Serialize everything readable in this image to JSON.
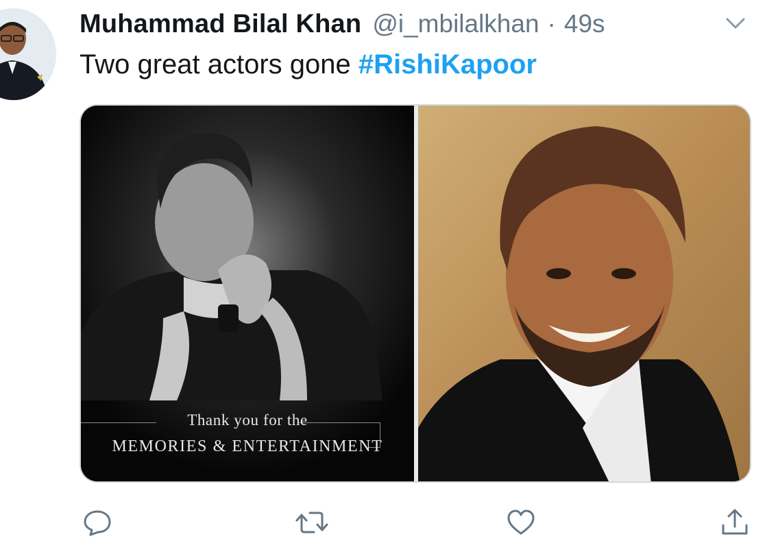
{
  "user": {
    "name": "Muhammad Bilal Khan",
    "handle": "@i_mbilalkhan",
    "separator": "·",
    "time": "49s"
  },
  "tweet": {
    "text": "Two great actors gone ",
    "hashtag": "#RishiKapoor"
  },
  "media": {
    "left_caption_line1": "Thank you for the",
    "left_caption_line2": "MEMORIES & ENTERTAINMENT"
  },
  "icons": {
    "menu": "chevron-down-icon",
    "reply": "reply-icon",
    "retweet": "retweet-icon",
    "like": "like-icon",
    "share": "share-icon"
  },
  "colors": {
    "text": "#14171a",
    "secondary": "#657786",
    "link": "#1da1f2"
  }
}
